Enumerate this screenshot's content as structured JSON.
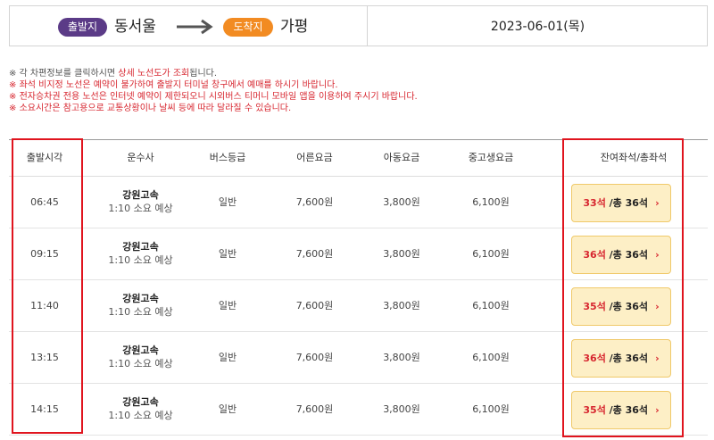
{
  "route": {
    "departure_badge": "출발지",
    "departure_city": "동서울",
    "arrival_badge": "도착지",
    "arrival_city": "가평",
    "date": "2023-06-01(목)",
    "colors": {
      "departure_badge": "#5b3b87",
      "arrival_badge": "#f28b22"
    }
  },
  "notices": [
    {
      "prefix": "※ 각 차편정보를 클릭하시면 ",
      "highlight": "상세 노선도가 조회",
      "suffix": "됩니다."
    },
    {
      "prefix": "※ ",
      "highlight": "좌석 비지정 노선은 예약이 불가",
      "suffix": "하여 출발지 터미널 창구에서 예매를 하시기 바랍니다."
    },
    {
      "prefix": "※ ",
      "highlight": "전자승차권 전용 노선은 인터넷 예약이 제한",
      "suffix": "되오니 시외버스 티머니 모바일 앱을 이용하여 주시기 바랍니다."
    },
    {
      "prefix": "※ ",
      "highlight": "소요시간은 참고용으로 교통상황이나 날씨 등에 따라 달라질 수",
      "suffix": " 있습니다."
    }
  ],
  "table": {
    "headers": {
      "time": "출발시각",
      "company": "운수사",
      "grade": "버스등급",
      "adult": "어른요금",
      "child": "아동요금",
      "youth": "중고생요금",
      "seats": "잔여좌석/총좌석"
    },
    "rows": [
      {
        "time": "06:45",
        "company": "강원고속",
        "duration": "1:10 소요 예상",
        "grade": "일반",
        "adult": "7,600원",
        "child": "3,800원",
        "youth": "6,100원",
        "remaining": "33석",
        "total": " /총 36석",
        "chevron": "›"
      },
      {
        "time": "09:15",
        "company": "강원고속",
        "duration": "1:10 소요 예상",
        "grade": "일반",
        "adult": "7,600원",
        "child": "3,800원",
        "youth": "6,100원",
        "remaining": "36석",
        "total": " /총 36석",
        "chevron": "›"
      },
      {
        "time": "11:40",
        "company": "강원고속",
        "duration": "1:10 소요 예상",
        "grade": "일반",
        "adult": "7,600원",
        "child": "3,800원",
        "youth": "6,100원",
        "remaining": "35석",
        "total": " /총 36석",
        "chevron": "›"
      },
      {
        "time": "13:15",
        "company": "강원고속",
        "duration": "1:10 소요 예상",
        "grade": "일반",
        "adult": "7,600원",
        "child": "3,800원",
        "youth": "6,100원",
        "remaining": "36석",
        "total": " /총 36석",
        "chevron": "›"
      },
      {
        "time": "14:15",
        "company": "강원고속",
        "duration": "1:10 소요 예상",
        "grade": "일반",
        "adult": "7,600원",
        "child": "3,800원",
        "youth": "6,100원",
        "remaining": "35석",
        "total": " /총 36석",
        "chevron": "›"
      }
    ]
  },
  "highlight_color": "#e0141e"
}
